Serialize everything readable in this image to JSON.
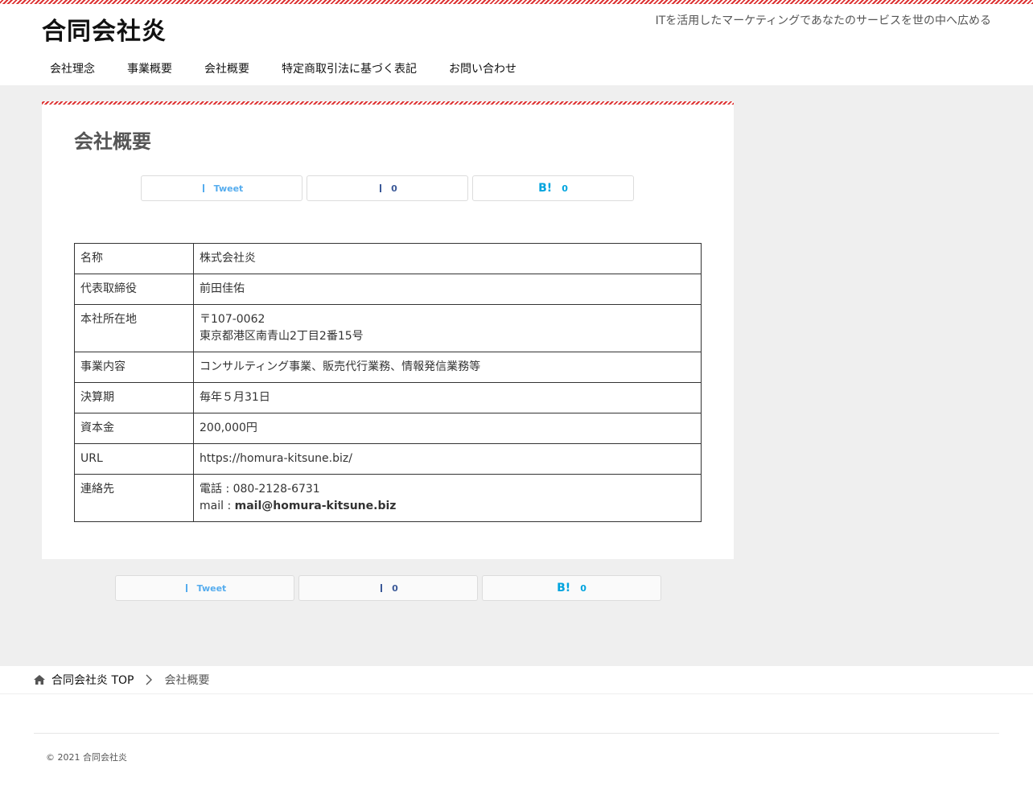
{
  "header": {
    "site_title": "合同会社炎",
    "tagline": "ITを活用したマーケティングであなたのサービスを世の中へ広める"
  },
  "nav": {
    "items": [
      {
        "label": "会社理念"
      },
      {
        "label": "事業概要"
      },
      {
        "label": "会社概要"
      },
      {
        "label": "特定商取引法に基づく表記"
      },
      {
        "label": "お問い合わせ"
      }
    ]
  },
  "article": {
    "title": "会社概要",
    "share": {
      "tweet_label": "Tweet",
      "facebook_count": "0",
      "hatena_mark": "B!",
      "hatena_count": "0"
    },
    "company_table": {
      "rows": [
        {
          "key": "名称",
          "value": "株式会社炎"
        },
        {
          "key": "代表取締役",
          "value": "前田佳佑"
        },
        {
          "key": "本社所在地",
          "value_lines": [
            "〒107-0062",
            "東京都港区南青山2丁目2番15号"
          ]
        },
        {
          "key": "事業内容",
          "value": "コンサルティング事業、販売代行業務、情報発信業務等"
        },
        {
          "key": "決算期",
          "value": "毎年５月31日"
        },
        {
          "key": "資本金",
          "value": "200,000円"
        },
        {
          "key": "URL",
          "value": "https://homura-kitsune.biz/"
        },
        {
          "key": "連絡先",
          "phone": "電話 : 080-2128-6731",
          "mail_prefix": "mail : ",
          "mail": "mail@homura-kitsune.biz"
        }
      ]
    }
  },
  "breadcrumb": {
    "home_label": "合同会社炎 TOP",
    "current": "会社概要"
  },
  "footer": {
    "copyright": "© 2021 合同会社炎"
  },
  "icons": {
    "home": "home-icon",
    "chevron": "chevron-right-icon",
    "twitter": "twitter-icon",
    "facebook": "facebook-icon"
  },
  "colors": {
    "accent_stripe": "#dd3333",
    "twitter": "#55acee",
    "facebook": "#3b5998",
    "hatena": "#00a4de",
    "content_bg": "#efefef"
  }
}
